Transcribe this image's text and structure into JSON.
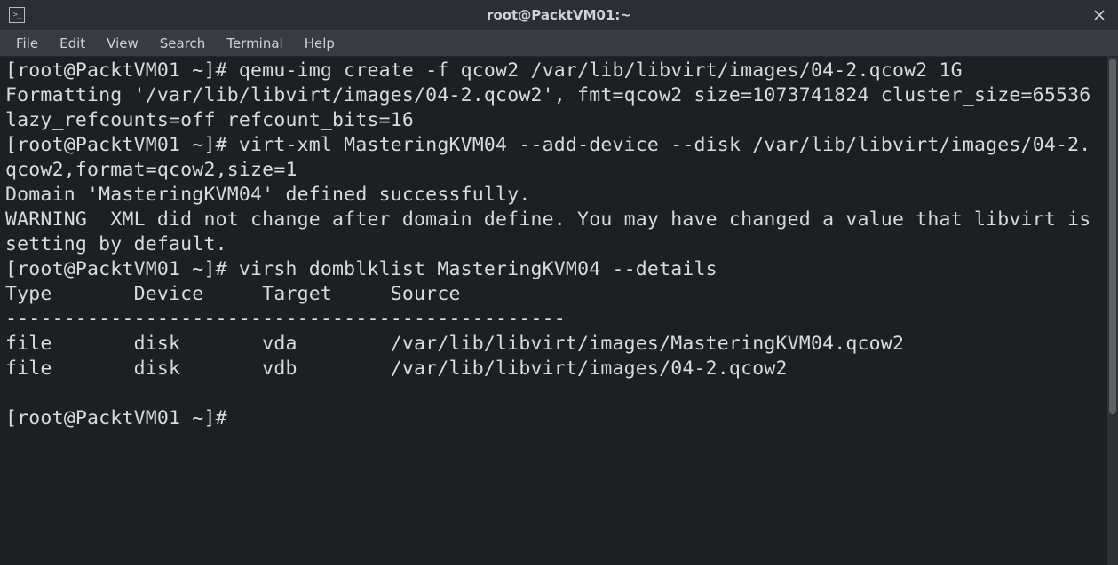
{
  "titlebar": {
    "title": "root@PacktVM01:~"
  },
  "menubar": {
    "items": [
      "File",
      "Edit",
      "View",
      "Search",
      "Terminal",
      "Help"
    ]
  },
  "terminal": {
    "prompt1": "[root@PacktVM01 ~]# ",
    "cmd1": "qemu-img create -f qcow2 /var/lib/libvirt/images/04-2.qcow2 1G",
    "out1": "Formatting '/var/lib/libvirt/images/04-2.qcow2', fmt=qcow2 size=1073741824 cluster_size=65536 lazy_refcounts=off refcount_bits=16",
    "prompt2": "[root@PacktVM01 ~]# ",
    "cmd2": "virt-xml MasteringKVM04 --add-device --disk /var/lib/libvirt/images/04-2.qcow2,format=qcow2,size=1",
    "out2a": "Domain 'MasteringKVM04' defined successfully.",
    "out2b": "WARNING  XML did not change after domain define. You may have changed a value that libvirt is setting by default.",
    "prompt3": "[root@PacktVM01 ~]# ",
    "cmd3": "virsh domblklist MasteringKVM04 --details",
    "table_header": "Type       Device     Target     Source",
    "table_sep": "------------------------------------------------",
    "table_row1": "file       disk       vda        /var/lib/libvirt/images/MasteringKVM04.qcow2",
    "table_row2": "file       disk       vdb        /var/lib/libvirt/images/04-2.qcow2",
    "blank": "",
    "prompt4": "[root@PacktVM01 ~]# "
  }
}
